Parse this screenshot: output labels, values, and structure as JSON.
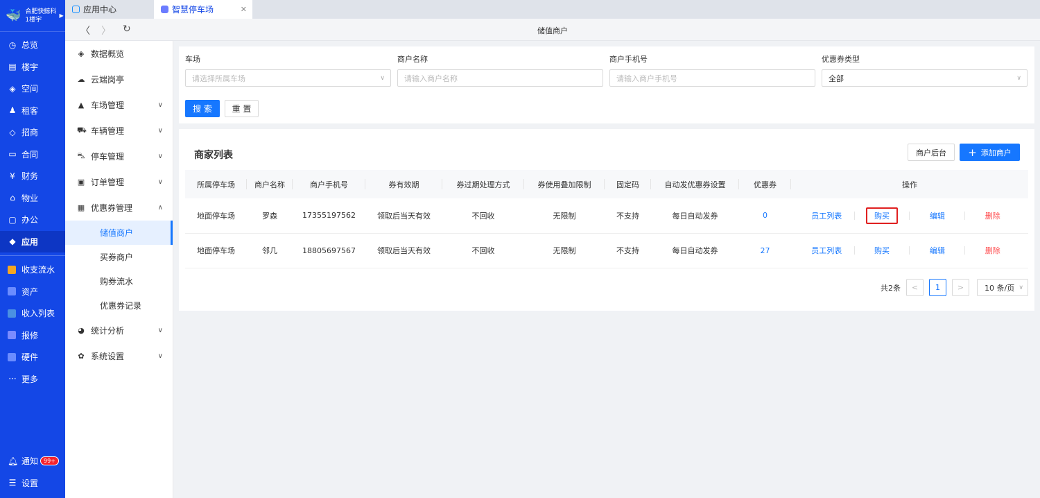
{
  "rail": {
    "brand_name": "合肥快鲸科",
    "building": "1楼宇",
    "items": [
      {
        "label": "总览",
        "icon": "dashboard-icon"
      },
      {
        "label": "楼宇",
        "icon": "building-icon"
      },
      {
        "label": "空间",
        "icon": "cube-icon"
      },
      {
        "label": "租客",
        "icon": "people-icon"
      },
      {
        "label": "招商",
        "icon": "tag-icon"
      },
      {
        "label": "合同",
        "icon": "document-icon"
      },
      {
        "label": "财务",
        "icon": "yen-icon"
      },
      {
        "label": "物业",
        "icon": "home-icon"
      },
      {
        "label": "办公",
        "icon": "monitor-icon"
      },
      {
        "label": "应用",
        "icon": "app-icon"
      }
    ],
    "apps": [
      {
        "label": "收支流水",
        "color": "#f5a623"
      },
      {
        "label": "资产",
        "color": "#6b8cff"
      },
      {
        "label": "收入列表",
        "color": "#4a90e2"
      },
      {
        "label": "报修",
        "color": "#7b8bff"
      },
      {
        "label": "硬件",
        "color": "#6b8cff"
      }
    ],
    "more": "更多",
    "notify": "通知",
    "notify_badge": "99+",
    "settings": "设置"
  },
  "tabs": [
    {
      "label": "应用中心"
    },
    {
      "label": "智慧停车场"
    }
  ],
  "page_title": "储值商户",
  "side": {
    "items": [
      {
        "label": "数据概览",
        "icon": "layers-icon"
      },
      {
        "label": "云端岗亭",
        "icon": "cloud-icon"
      },
      {
        "label": "车场管理",
        "icon": "road-icon"
      },
      {
        "label": "车辆管理",
        "icon": "car-icon"
      },
      {
        "label": "停车管理",
        "icon": "parking-icon"
      },
      {
        "label": "订单管理",
        "icon": "clipboard-icon"
      },
      {
        "label": "优惠券管理",
        "icon": "coupon-icon"
      },
      {
        "label": "统计分析",
        "icon": "pie-chart-icon"
      },
      {
        "label": "系统设置",
        "icon": "gear-icon"
      }
    ],
    "sub_items": [
      "储值商户",
      "买券商户",
      "购券流水",
      "优惠券记录"
    ]
  },
  "filter": {
    "lot_label": "车场",
    "lot_placeholder": "请选择所属车场",
    "name_label": "商户名称",
    "name_placeholder": "请输入商户名称",
    "phone_label": "商户手机号",
    "phone_placeholder": "请输入商户手机号",
    "type_label": "优惠券类型",
    "type_value": "全部",
    "search": "搜 索",
    "reset": "重 置"
  },
  "list": {
    "title": "商家列表",
    "merchant_backend": "商户后台",
    "add_merchant": "添加商户",
    "columns": [
      "所属停车场",
      "商户名称",
      "商户手机号",
      "券有效期",
      "券过期处理方式",
      "券使用叠加限制",
      "固定码",
      "自动发优惠券设置",
      "优惠券",
      "操作"
    ],
    "rows": [
      {
        "lot": "地面停车场",
        "name": "罗森",
        "phone": "17355197562",
        "validity": "领取后当天有效",
        "expiry": "不回收",
        "stack": "无限制",
        "fixed": "不支持",
        "auto": "每日自动发券",
        "coupons": "0"
      },
      {
        "lot": "地面停车场",
        "name": "邻几",
        "phone": "18805697567",
        "validity": "领取后当天有效",
        "expiry": "不回收",
        "stack": "无限制",
        "fixed": "不支持",
        "auto": "每日自动发券",
        "coupons": "27"
      }
    ],
    "ops": {
      "staff": "员工列表",
      "buy": "购买",
      "edit": "编辑",
      "delete": "删除"
    }
  },
  "pager": {
    "total": "共2条",
    "current": "1",
    "size": "10 条/页"
  }
}
